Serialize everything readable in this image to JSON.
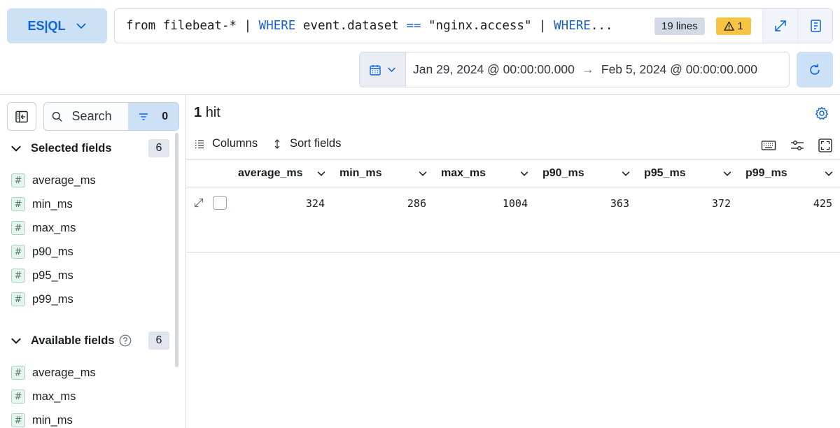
{
  "query_bar": {
    "mode_label": "ES|QL",
    "query_parts": [
      {
        "text": "from filebeat-* | ",
        "kw": false
      },
      {
        "text": "WHERE",
        "kw": true
      },
      {
        "text": " event.dataset ",
        "kw": false
      },
      {
        "text": "==",
        "kw": true
      },
      {
        "text": " \"nginx.access\" | ",
        "kw": false
      },
      {
        "text": "WHERE",
        "kw": true
      },
      {
        "text": "...",
        "kw": false
      }
    ],
    "lines_badge": "19 lines",
    "warning_count": "1"
  },
  "date_picker": {
    "start": "Jan 29, 2024 @ 00:00:00.000",
    "arrow": "→",
    "end": "Feb 5, 2024 @ 00:00:00.000"
  },
  "sidebar": {
    "search_placeholder": "Search",
    "filter_count": "0",
    "selected": {
      "title": "Selected fields",
      "count": "6",
      "fields": [
        "average_ms",
        "min_ms",
        "max_ms",
        "p90_ms",
        "p95_ms",
        "p99_ms"
      ]
    },
    "available": {
      "title": "Available fields",
      "count": "6",
      "fields": [
        "average_ms",
        "max_ms",
        "min_ms"
      ]
    },
    "field_type_symbol": "#"
  },
  "results": {
    "hit_count": "1",
    "hit_label": "hit",
    "columns_label": "Columns",
    "sort_label": "Sort fields",
    "columns": [
      "average_ms",
      "min_ms",
      "max_ms",
      "p90_ms",
      "p95_ms",
      "p99_ms"
    ],
    "rows": [
      [
        "324",
        "286",
        "1004",
        "363",
        "372",
        "425"
      ]
    ]
  },
  "colors": {
    "accent": "#0b64dd",
    "accent_bg": "#cce1f5",
    "warning": "#f6c343",
    "keyword": "#1d5ec4"
  }
}
